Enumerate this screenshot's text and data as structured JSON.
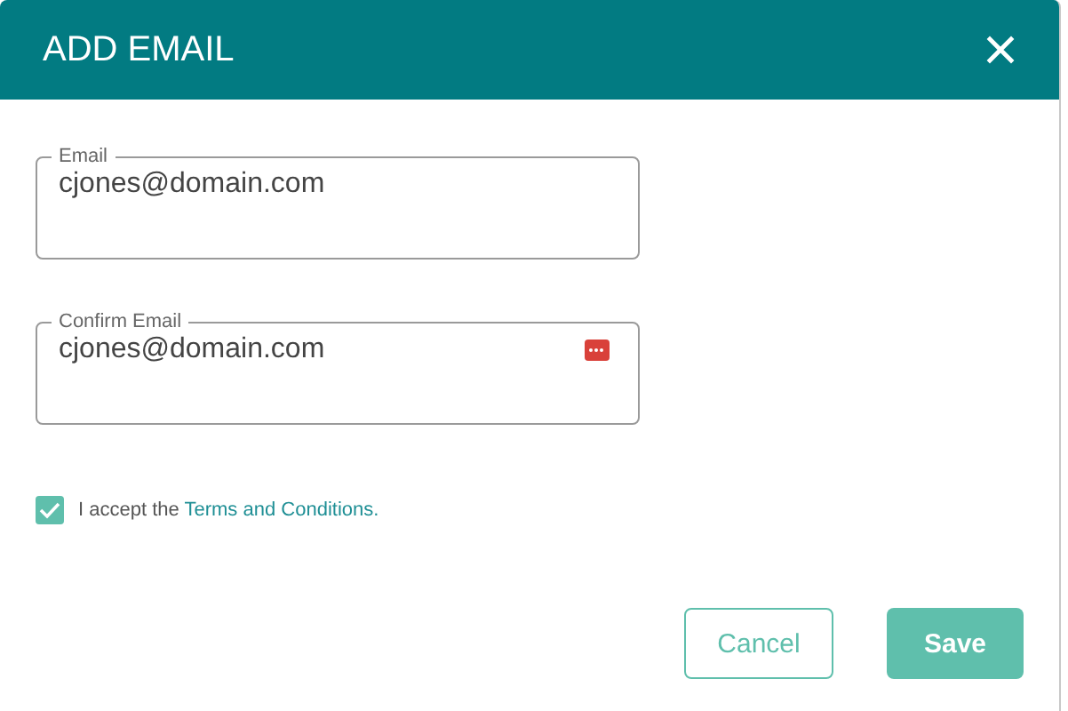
{
  "dialog": {
    "title": "ADD EMAIL"
  },
  "fields": [
    {
      "label": "Email",
      "value": "cjones@domain.com",
      "kind": "plain"
    },
    {
      "label": "Confirm Email",
      "value": "cjones@domain.com",
      "kind": "autofill"
    }
  ],
  "agreement": {
    "checked": true,
    "text": "I accept the ",
    "link": "Terms and Conditions."
  },
  "buttons": [
    {
      "label": "Cancel",
      "kind": "outline"
    },
    {
      "label": "Save",
      "kind": "primary"
    }
  ]
}
